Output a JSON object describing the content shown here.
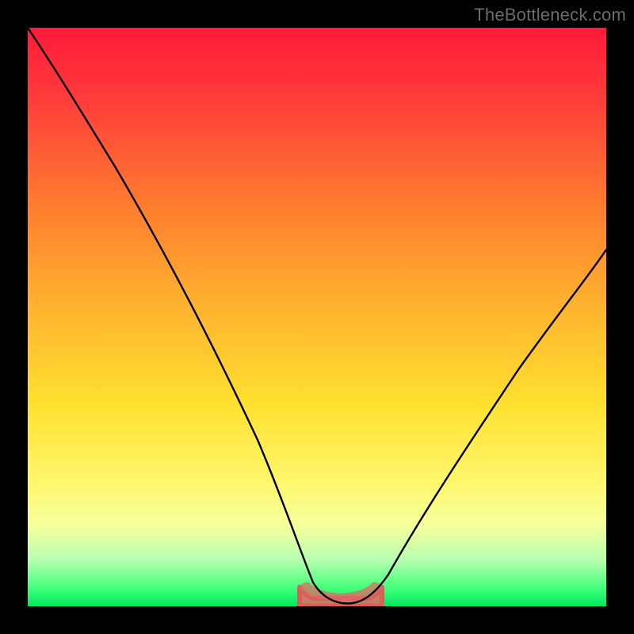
{
  "watermark": "TheBottleneck.com",
  "chart_data": {
    "type": "line",
    "title": "",
    "xlabel": "",
    "ylabel": "",
    "xlim": [
      0,
      100
    ],
    "ylim": [
      0,
      100
    ],
    "grid": false,
    "series": [
      {
        "name": "bottleneck-curve",
        "color": "#000000",
        "x": [
          0,
          6,
          12,
          18,
          24,
          30,
          36,
          42,
          47,
          50,
          53,
          56,
          58,
          60,
          64,
          70,
          78,
          86,
          94,
          100
        ],
        "y": [
          100,
          90,
          80,
          69,
          58,
          47,
          36,
          24,
          12,
          6,
          3,
          2,
          2,
          3,
          9,
          18,
          30,
          42,
          53,
          62
        ]
      }
    ],
    "highlight_region": {
      "name": "optimal-band",
      "color": "#e06a66",
      "y0": 0,
      "y1": 4,
      "x0": 47,
      "x1": 60
    }
  }
}
